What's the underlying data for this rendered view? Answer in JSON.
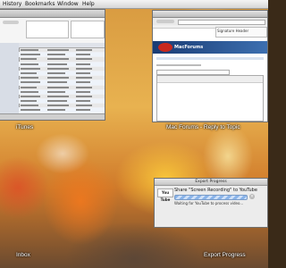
{
  "menubar": {
    "items": [
      "History",
      "Bookmarks",
      "Window",
      "Help"
    ]
  },
  "windows": {
    "itunes": {
      "label": "iTunes"
    },
    "browser": {
      "label": "Mac Forums - Reply to Topic",
      "signin_title": "Signature Header",
      "site_name": "MacForums"
    },
    "inbox": {
      "label": "Inbox"
    },
    "export": {
      "label": "Export Progress",
      "title": "Export Progress",
      "share_text": "Share \"Screen Recording\" to YouTube",
      "status": "Waiting for YouTube to process video...",
      "youtube_logo": "You Tube"
    }
  },
  "colors": {
    "youtube_red": "#e02020",
    "forum_banner": "#1a3c74",
    "progress": "#8ab4ea"
  }
}
